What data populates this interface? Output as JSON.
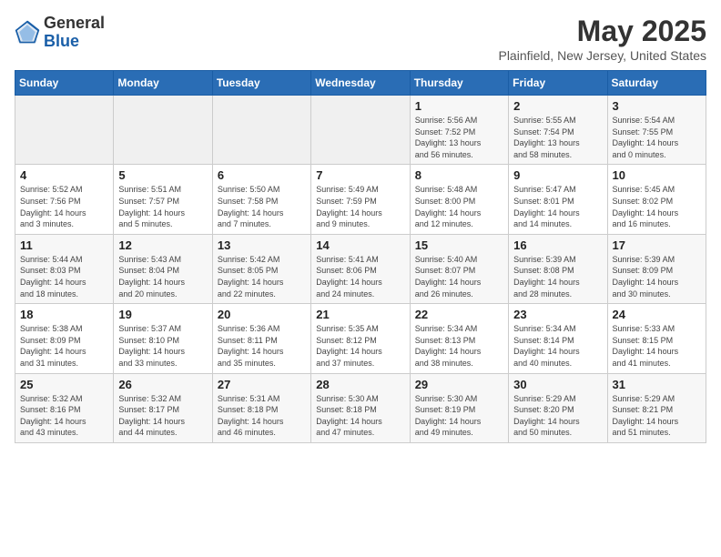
{
  "header": {
    "logo_general": "General",
    "logo_blue": "Blue",
    "month_title": "May 2025",
    "location": "Plainfield, New Jersey, United States"
  },
  "days_of_week": [
    "Sunday",
    "Monday",
    "Tuesday",
    "Wednesday",
    "Thursday",
    "Friday",
    "Saturday"
  ],
  "weeks": [
    [
      {
        "day": "",
        "info": ""
      },
      {
        "day": "",
        "info": ""
      },
      {
        "day": "",
        "info": ""
      },
      {
        "day": "",
        "info": ""
      },
      {
        "day": "1",
        "info": "Sunrise: 5:56 AM\nSunset: 7:52 PM\nDaylight: 13 hours\nand 56 minutes."
      },
      {
        "day": "2",
        "info": "Sunrise: 5:55 AM\nSunset: 7:54 PM\nDaylight: 13 hours\nand 58 minutes."
      },
      {
        "day": "3",
        "info": "Sunrise: 5:54 AM\nSunset: 7:55 PM\nDaylight: 14 hours\nand 0 minutes."
      }
    ],
    [
      {
        "day": "4",
        "info": "Sunrise: 5:52 AM\nSunset: 7:56 PM\nDaylight: 14 hours\nand 3 minutes."
      },
      {
        "day": "5",
        "info": "Sunrise: 5:51 AM\nSunset: 7:57 PM\nDaylight: 14 hours\nand 5 minutes."
      },
      {
        "day": "6",
        "info": "Sunrise: 5:50 AM\nSunset: 7:58 PM\nDaylight: 14 hours\nand 7 minutes."
      },
      {
        "day": "7",
        "info": "Sunrise: 5:49 AM\nSunset: 7:59 PM\nDaylight: 14 hours\nand 9 minutes."
      },
      {
        "day": "8",
        "info": "Sunrise: 5:48 AM\nSunset: 8:00 PM\nDaylight: 14 hours\nand 12 minutes."
      },
      {
        "day": "9",
        "info": "Sunrise: 5:47 AM\nSunset: 8:01 PM\nDaylight: 14 hours\nand 14 minutes."
      },
      {
        "day": "10",
        "info": "Sunrise: 5:45 AM\nSunset: 8:02 PM\nDaylight: 14 hours\nand 16 minutes."
      }
    ],
    [
      {
        "day": "11",
        "info": "Sunrise: 5:44 AM\nSunset: 8:03 PM\nDaylight: 14 hours\nand 18 minutes."
      },
      {
        "day": "12",
        "info": "Sunrise: 5:43 AM\nSunset: 8:04 PM\nDaylight: 14 hours\nand 20 minutes."
      },
      {
        "day": "13",
        "info": "Sunrise: 5:42 AM\nSunset: 8:05 PM\nDaylight: 14 hours\nand 22 minutes."
      },
      {
        "day": "14",
        "info": "Sunrise: 5:41 AM\nSunset: 8:06 PM\nDaylight: 14 hours\nand 24 minutes."
      },
      {
        "day": "15",
        "info": "Sunrise: 5:40 AM\nSunset: 8:07 PM\nDaylight: 14 hours\nand 26 minutes."
      },
      {
        "day": "16",
        "info": "Sunrise: 5:39 AM\nSunset: 8:08 PM\nDaylight: 14 hours\nand 28 minutes."
      },
      {
        "day": "17",
        "info": "Sunrise: 5:39 AM\nSunset: 8:09 PM\nDaylight: 14 hours\nand 30 minutes."
      }
    ],
    [
      {
        "day": "18",
        "info": "Sunrise: 5:38 AM\nSunset: 8:09 PM\nDaylight: 14 hours\nand 31 minutes."
      },
      {
        "day": "19",
        "info": "Sunrise: 5:37 AM\nSunset: 8:10 PM\nDaylight: 14 hours\nand 33 minutes."
      },
      {
        "day": "20",
        "info": "Sunrise: 5:36 AM\nSunset: 8:11 PM\nDaylight: 14 hours\nand 35 minutes."
      },
      {
        "day": "21",
        "info": "Sunrise: 5:35 AM\nSunset: 8:12 PM\nDaylight: 14 hours\nand 37 minutes."
      },
      {
        "day": "22",
        "info": "Sunrise: 5:34 AM\nSunset: 8:13 PM\nDaylight: 14 hours\nand 38 minutes."
      },
      {
        "day": "23",
        "info": "Sunrise: 5:34 AM\nSunset: 8:14 PM\nDaylight: 14 hours\nand 40 minutes."
      },
      {
        "day": "24",
        "info": "Sunrise: 5:33 AM\nSunset: 8:15 PM\nDaylight: 14 hours\nand 41 minutes."
      }
    ],
    [
      {
        "day": "25",
        "info": "Sunrise: 5:32 AM\nSunset: 8:16 PM\nDaylight: 14 hours\nand 43 minutes."
      },
      {
        "day": "26",
        "info": "Sunrise: 5:32 AM\nSunset: 8:17 PM\nDaylight: 14 hours\nand 44 minutes."
      },
      {
        "day": "27",
        "info": "Sunrise: 5:31 AM\nSunset: 8:18 PM\nDaylight: 14 hours\nand 46 minutes."
      },
      {
        "day": "28",
        "info": "Sunrise: 5:30 AM\nSunset: 8:18 PM\nDaylight: 14 hours\nand 47 minutes."
      },
      {
        "day": "29",
        "info": "Sunrise: 5:30 AM\nSunset: 8:19 PM\nDaylight: 14 hours\nand 49 minutes."
      },
      {
        "day": "30",
        "info": "Sunrise: 5:29 AM\nSunset: 8:20 PM\nDaylight: 14 hours\nand 50 minutes."
      },
      {
        "day": "31",
        "info": "Sunrise: 5:29 AM\nSunset: 8:21 PM\nDaylight: 14 hours\nand 51 minutes."
      }
    ]
  ]
}
